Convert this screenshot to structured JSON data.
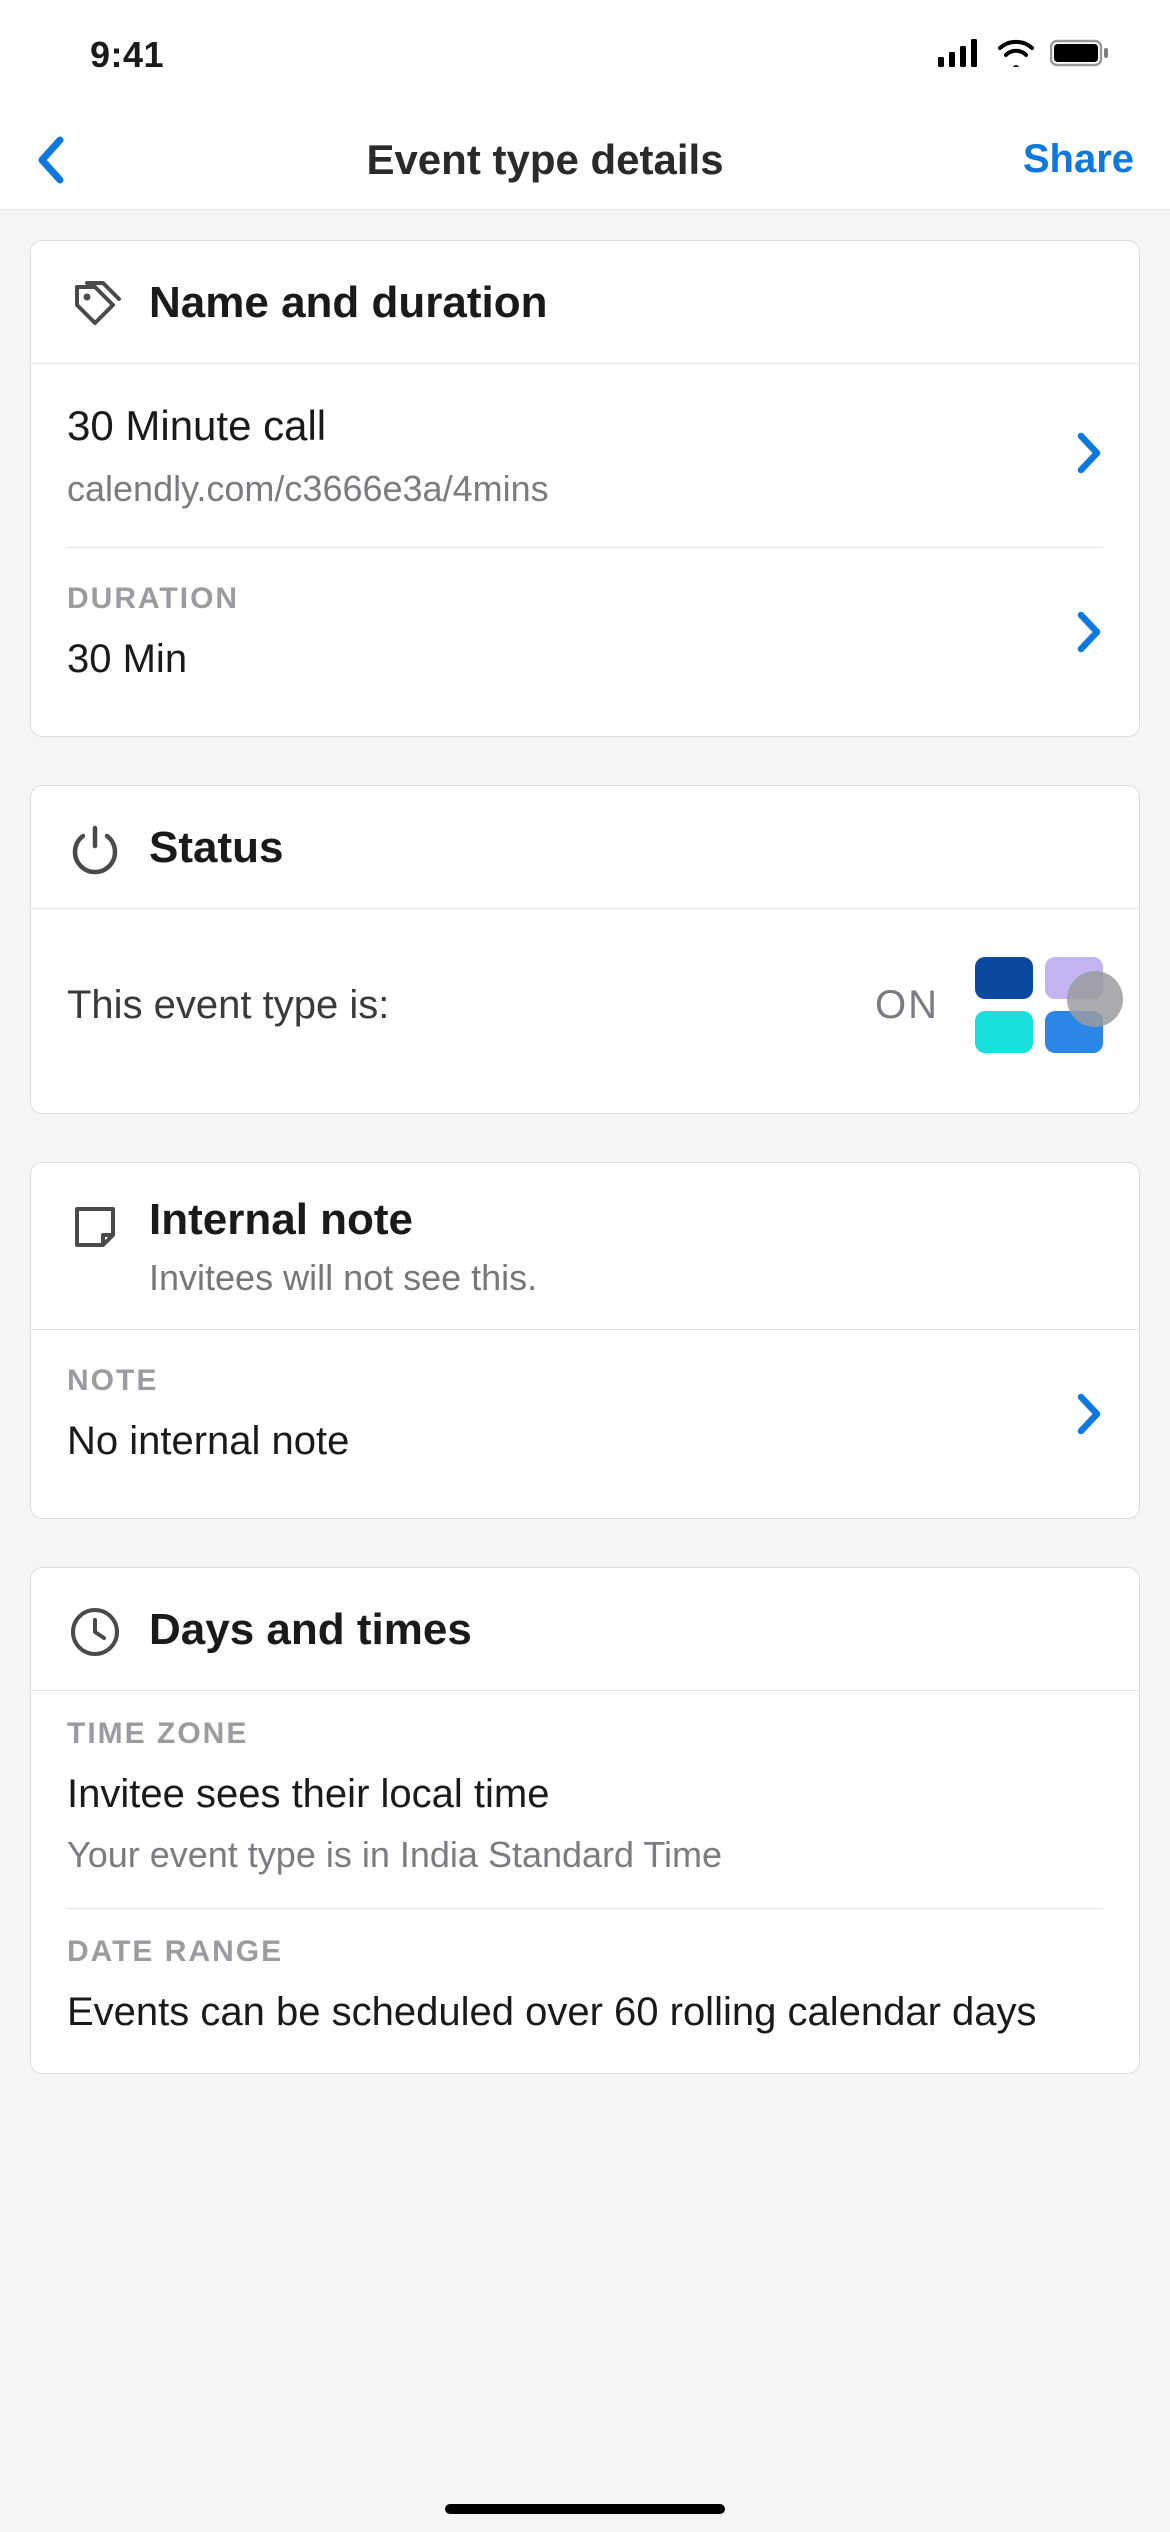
{
  "status_bar": {
    "time": "9:41"
  },
  "nav": {
    "title": "Event type details",
    "share": "Share"
  },
  "sections": {
    "name_duration": {
      "title": "Name and duration",
      "event_name": "30 Minute call",
      "event_url": "calendly.com/c3666e3a/4mins",
      "duration_label": "DURATION",
      "duration_value": "30 Min"
    },
    "status": {
      "title": "Status",
      "label": "This event type is:",
      "value": "ON"
    },
    "internal_note": {
      "title": "Internal note",
      "subtitle": "Invitees will not see this.",
      "note_label": "NOTE",
      "note_value": "No internal note"
    },
    "days_times": {
      "title": "Days and times",
      "tz_label": "TIME ZONE",
      "tz_value": "Invitee sees their local time",
      "tz_sub": "Your event type is in India Standard Time",
      "range_label": "DATE RANGE",
      "range_value": "Events can be scheduled over 60 rolling calendar days"
    }
  },
  "colors": {
    "accent": "#0f78e0"
  }
}
